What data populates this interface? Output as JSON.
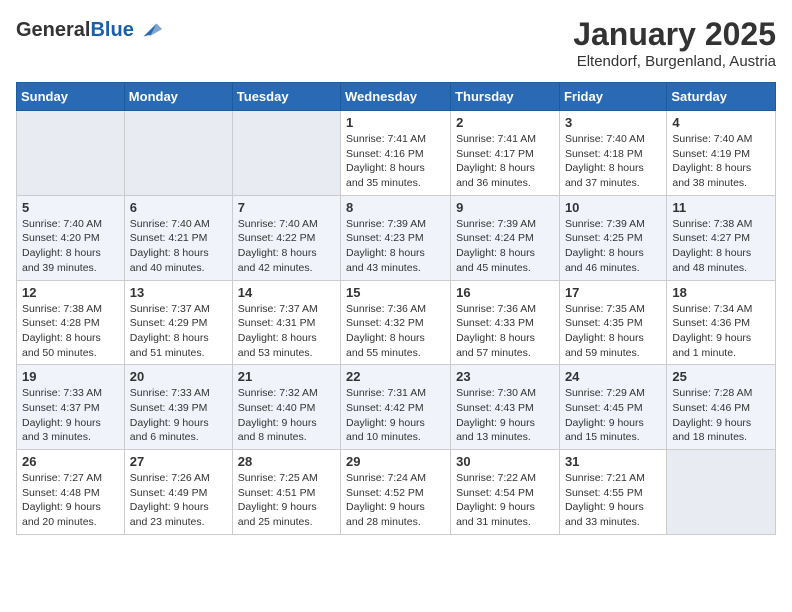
{
  "header": {
    "logo_general": "General",
    "logo_blue": "Blue",
    "month": "January 2025",
    "location": "Eltendorf, Burgenland, Austria"
  },
  "weekdays": [
    "Sunday",
    "Monday",
    "Tuesday",
    "Wednesday",
    "Thursday",
    "Friday",
    "Saturday"
  ],
  "weeks": [
    [
      {
        "day": "",
        "info": ""
      },
      {
        "day": "",
        "info": ""
      },
      {
        "day": "",
        "info": ""
      },
      {
        "day": "1",
        "info": "Sunrise: 7:41 AM\nSunset: 4:16 PM\nDaylight: 8 hours and 35 minutes."
      },
      {
        "day": "2",
        "info": "Sunrise: 7:41 AM\nSunset: 4:17 PM\nDaylight: 8 hours and 36 minutes."
      },
      {
        "day": "3",
        "info": "Sunrise: 7:40 AM\nSunset: 4:18 PM\nDaylight: 8 hours and 37 minutes."
      },
      {
        "day": "4",
        "info": "Sunrise: 7:40 AM\nSunset: 4:19 PM\nDaylight: 8 hours and 38 minutes."
      }
    ],
    [
      {
        "day": "5",
        "info": "Sunrise: 7:40 AM\nSunset: 4:20 PM\nDaylight: 8 hours and 39 minutes."
      },
      {
        "day": "6",
        "info": "Sunrise: 7:40 AM\nSunset: 4:21 PM\nDaylight: 8 hours and 40 minutes."
      },
      {
        "day": "7",
        "info": "Sunrise: 7:40 AM\nSunset: 4:22 PM\nDaylight: 8 hours and 42 minutes."
      },
      {
        "day": "8",
        "info": "Sunrise: 7:39 AM\nSunset: 4:23 PM\nDaylight: 8 hours and 43 minutes."
      },
      {
        "day": "9",
        "info": "Sunrise: 7:39 AM\nSunset: 4:24 PM\nDaylight: 8 hours and 45 minutes."
      },
      {
        "day": "10",
        "info": "Sunrise: 7:39 AM\nSunset: 4:25 PM\nDaylight: 8 hours and 46 minutes."
      },
      {
        "day": "11",
        "info": "Sunrise: 7:38 AM\nSunset: 4:27 PM\nDaylight: 8 hours and 48 minutes."
      }
    ],
    [
      {
        "day": "12",
        "info": "Sunrise: 7:38 AM\nSunset: 4:28 PM\nDaylight: 8 hours and 50 minutes."
      },
      {
        "day": "13",
        "info": "Sunrise: 7:37 AM\nSunset: 4:29 PM\nDaylight: 8 hours and 51 minutes."
      },
      {
        "day": "14",
        "info": "Sunrise: 7:37 AM\nSunset: 4:31 PM\nDaylight: 8 hours and 53 minutes."
      },
      {
        "day": "15",
        "info": "Sunrise: 7:36 AM\nSunset: 4:32 PM\nDaylight: 8 hours and 55 minutes."
      },
      {
        "day": "16",
        "info": "Sunrise: 7:36 AM\nSunset: 4:33 PM\nDaylight: 8 hours and 57 minutes."
      },
      {
        "day": "17",
        "info": "Sunrise: 7:35 AM\nSunset: 4:35 PM\nDaylight: 8 hours and 59 minutes."
      },
      {
        "day": "18",
        "info": "Sunrise: 7:34 AM\nSunset: 4:36 PM\nDaylight: 9 hours and 1 minute."
      }
    ],
    [
      {
        "day": "19",
        "info": "Sunrise: 7:33 AM\nSunset: 4:37 PM\nDaylight: 9 hours and 3 minutes."
      },
      {
        "day": "20",
        "info": "Sunrise: 7:33 AM\nSunset: 4:39 PM\nDaylight: 9 hours and 6 minutes."
      },
      {
        "day": "21",
        "info": "Sunrise: 7:32 AM\nSunset: 4:40 PM\nDaylight: 9 hours and 8 minutes."
      },
      {
        "day": "22",
        "info": "Sunrise: 7:31 AM\nSunset: 4:42 PM\nDaylight: 9 hours and 10 minutes."
      },
      {
        "day": "23",
        "info": "Sunrise: 7:30 AM\nSunset: 4:43 PM\nDaylight: 9 hours and 13 minutes."
      },
      {
        "day": "24",
        "info": "Sunrise: 7:29 AM\nSunset: 4:45 PM\nDaylight: 9 hours and 15 minutes."
      },
      {
        "day": "25",
        "info": "Sunrise: 7:28 AM\nSunset: 4:46 PM\nDaylight: 9 hours and 18 minutes."
      }
    ],
    [
      {
        "day": "26",
        "info": "Sunrise: 7:27 AM\nSunset: 4:48 PM\nDaylight: 9 hours and 20 minutes."
      },
      {
        "day": "27",
        "info": "Sunrise: 7:26 AM\nSunset: 4:49 PM\nDaylight: 9 hours and 23 minutes."
      },
      {
        "day": "28",
        "info": "Sunrise: 7:25 AM\nSunset: 4:51 PM\nDaylight: 9 hours and 25 minutes."
      },
      {
        "day": "29",
        "info": "Sunrise: 7:24 AM\nSunset: 4:52 PM\nDaylight: 9 hours and 28 minutes."
      },
      {
        "day": "30",
        "info": "Sunrise: 7:22 AM\nSunset: 4:54 PM\nDaylight: 9 hours and 31 minutes."
      },
      {
        "day": "31",
        "info": "Sunrise: 7:21 AM\nSunset: 4:55 PM\nDaylight: 9 hours and 33 minutes."
      },
      {
        "day": "",
        "info": ""
      }
    ]
  ]
}
